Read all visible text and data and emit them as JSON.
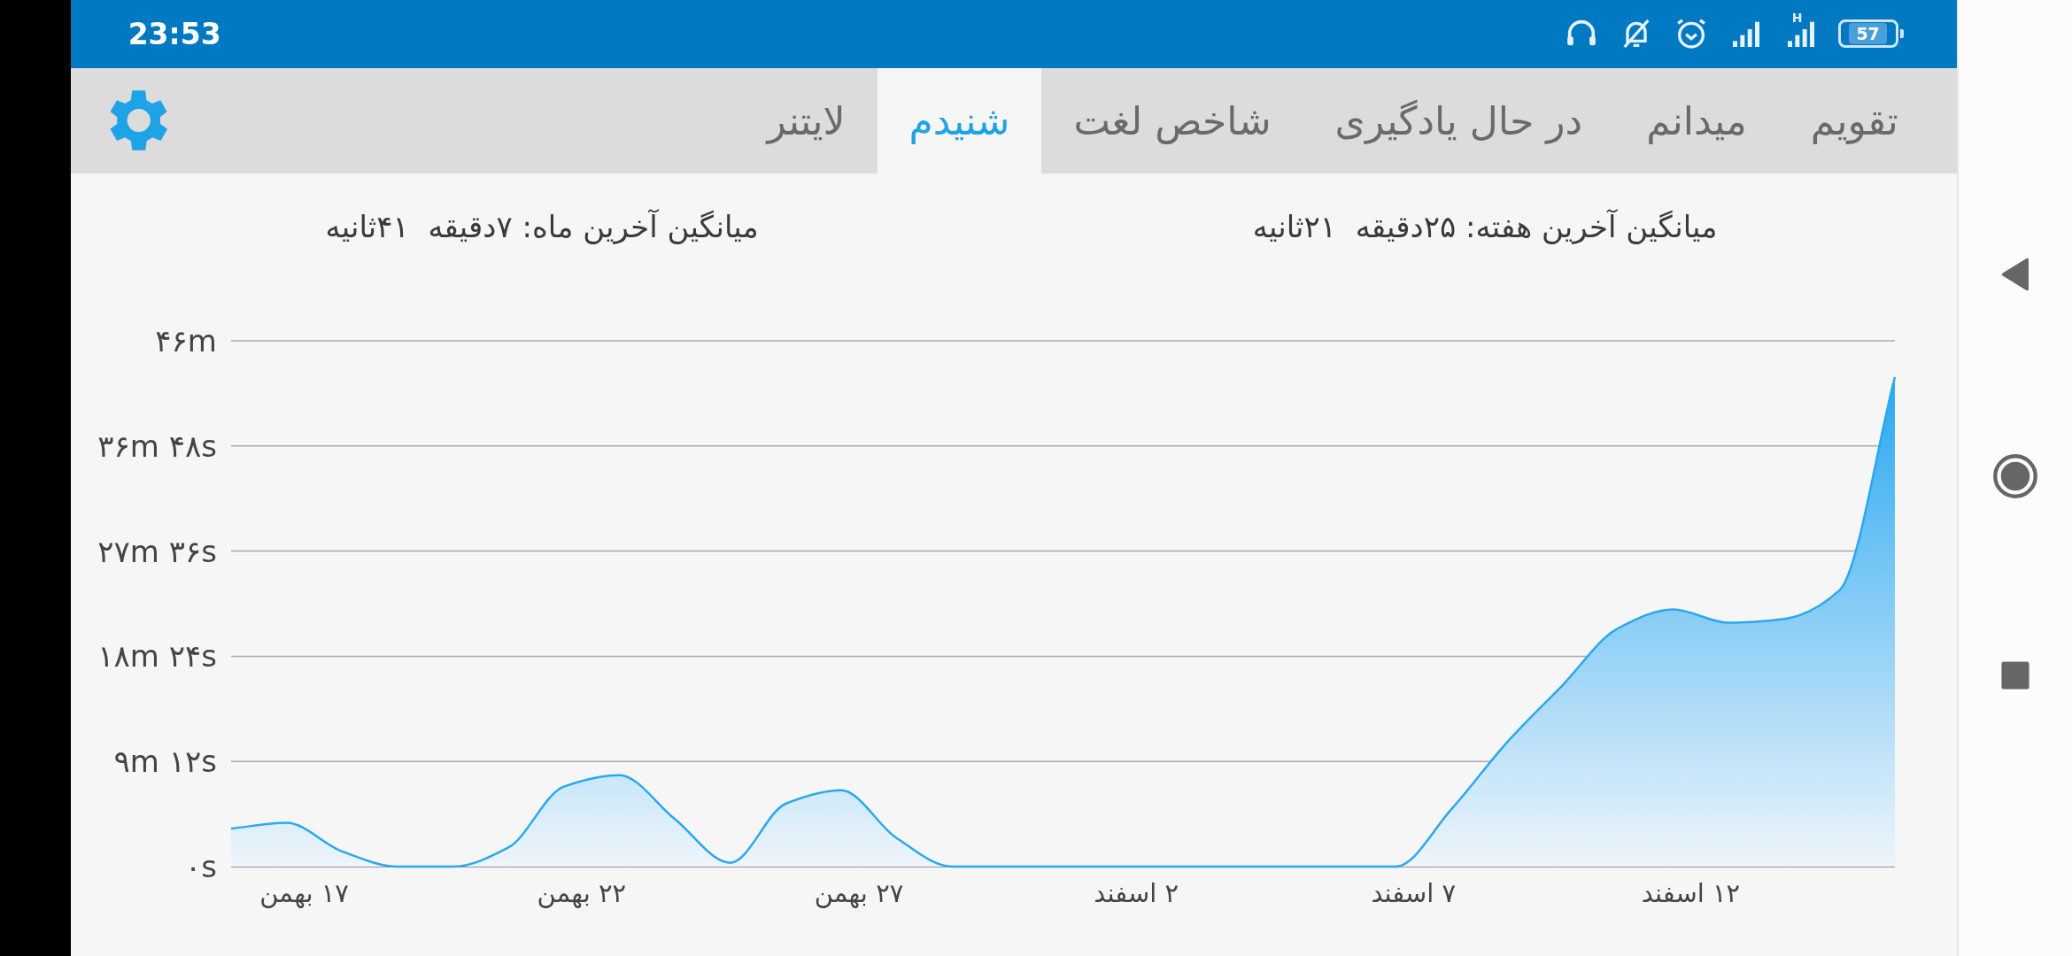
{
  "status_bar": {
    "time": "23:53",
    "network_type": "H",
    "battery": "57"
  },
  "tabs": [
    {
      "label": "تقویم",
      "selected": false
    },
    {
      "label": "میدانم",
      "selected": false
    },
    {
      "label": "در حال یادگیری",
      "selected": false
    },
    {
      "label": "شاخص لغت",
      "selected": false
    },
    {
      "label": "شنیدم",
      "selected": true
    },
    {
      "label": "لایتنر",
      "selected": false
    }
  ],
  "stats": [
    "میانگین آخرین هفته: ۲۵دقیقه  ۲۱ثانیه",
    "میانگین آخرین ماه: ۷دقیقه  ۴۱ثانیه"
  ],
  "chart": {
    "chart_data": {
      "type": "area",
      "grid": true,
      "categories": [
        null,
        "۱۷ بهمن",
        null,
        null,
        null,
        null,
        "۲۲ بهمن",
        null,
        null,
        null,
        null,
        "۲۷ بهمن",
        null,
        null,
        null,
        null,
        "۲ اسفند",
        null,
        null,
        null,
        null,
        "۷ اسفند",
        null,
        null,
        null,
        null,
        "۱۲ اسفند",
        null,
        null,
        null,
        null
      ],
      "series": [
        {
          "color": "#29a8f0",
          "values": [
            3.33,
            3.83,
            1.33,
            0,
            0,
            1.67,
            7,
            8,
            4.17,
            0.33,
            5.5,
            6.67,
            2.5,
            0,
            0,
            0,
            0,
            0,
            0,
            0,
            0,
            0,
            5,
            10.83,
            15.83,
            20.83,
            22.5,
            21.33,
            21.67,
            24.17,
            42.83
          ]
        }
      ],
      "ylim": [
        0,
        46
      ],
      "yticks": [
        {
          "value": 0,
          "label": "۰s"
        },
        {
          "value": 9.2,
          "label": "۹m ۱۲s"
        },
        {
          "value": 18.4,
          "label": "۱۸m ۲۴s"
        },
        {
          "value": 27.6,
          "label": "۲۷m ۳۶s"
        },
        {
          "value": 36.8,
          "label": "۳۶m ۴۸s"
        },
        {
          "value": 46,
          "label": "۴۶m"
        }
      ]
    }
  }
}
